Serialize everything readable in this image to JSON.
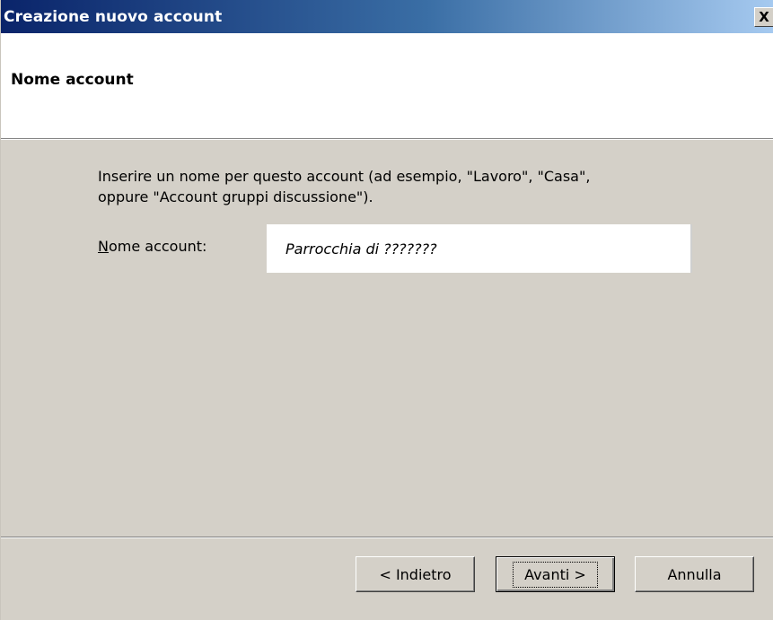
{
  "window": {
    "title": "Creazione nuovo account",
    "close_label": "X"
  },
  "header": {
    "title": "Nome account"
  },
  "main": {
    "instructions_line1": "Inserire un nome per questo account (ad esempio, \"Lavoro\", \"Casa\",",
    "instructions_line2": "oppure \"Account gruppi discussione\").",
    "field_label_accel": "N",
    "field_label_rest": "ome account:",
    "field_value": "Parrocchia di ???????"
  },
  "footer": {
    "back_label": "< Indietro",
    "next_label": "Avanti >",
    "cancel_label": "Annulla"
  }
}
